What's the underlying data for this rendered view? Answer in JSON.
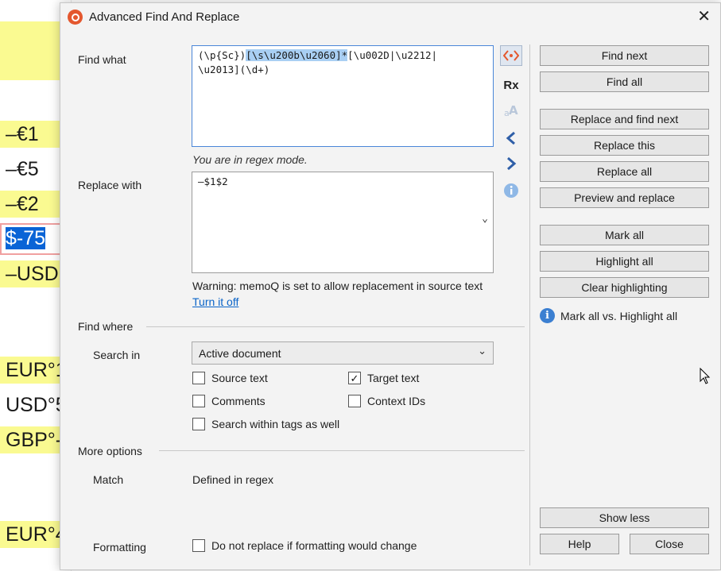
{
  "background_editor": {
    "cells": [
      {
        "text": "–€1",
        "yellow": true
      },
      {
        "text": "–€5",
        "yellow": false
      },
      {
        "text": "–€2",
        "yellow": true
      },
      {
        "text": "$-75",
        "yellow": false,
        "selected": true
      },
      {
        "text": "–USD",
        "yellow": true
      },
      {
        "text": "EUR°1",
        "yellow": true
      },
      {
        "text": "USD°5",
        "yellow": false
      },
      {
        "text": "GBP°-",
        "yellow": true
      },
      {
        "text": "EUR°4",
        "yellow": true
      }
    ]
  },
  "dialog": {
    "title": "Advanced Find And Replace",
    "close_glyph": "✕",
    "find_what": {
      "label": "Find what",
      "value_part1": "(\\p{Sc})",
      "value_highlight": "[\\s\\u200b\\u2060]*",
      "value_part2": "[\\u002D|\\u2212|",
      "value_line2": "\\u2013](\\d+)"
    },
    "regex_mode_note": "You are in regex mode.",
    "replace_with": {
      "label": "Replace with",
      "value": "–$1$2"
    },
    "warning": {
      "text": "Warning: memoQ is set to allow replacement in source text",
      "link": "Turn it off"
    },
    "find_where": {
      "heading": "Find where",
      "search_in_label": "Search in",
      "search_in_value": "Active document",
      "checkboxes": {
        "source_text": {
          "label": "Source text",
          "checked": false
        },
        "target_text": {
          "label": "Target text",
          "checked": true
        },
        "comments": {
          "label": "Comments",
          "checked": false
        },
        "context_ids": {
          "label": "Context IDs",
          "checked": false
        },
        "within_tags": {
          "label": "Search within tags as well",
          "checked": false
        }
      }
    },
    "more_options": {
      "heading": "More options",
      "match_label": "Match",
      "match_value": "Defined in regex",
      "formatting_label": "Formatting",
      "formatting_checkbox": {
        "label": "Do not replace if formatting would change",
        "checked": false
      }
    },
    "side_icons": [
      "regex-toggle-icon",
      "rx-icon",
      "font-case-icon",
      "previous-arrow-icon",
      "next-arrow-icon",
      "info-icon"
    ],
    "rx_label": "Rx",
    "buttons": {
      "find_next": "Find next",
      "find_all": "Find all",
      "replace_and_find_next": "Replace and find next",
      "replace_this": "Replace this",
      "replace_all": "Replace all",
      "preview_and_replace": "Preview and replace",
      "mark_all": "Mark all",
      "highlight_all": "Highlight all",
      "clear_highlighting": "Clear highlighting",
      "show_less": "Show less",
      "help": "Help",
      "close": "Close"
    },
    "info_link": "Mark all vs. Highlight all",
    "colors": {
      "accent": "#3b7fd1",
      "app_icon": "#e4572e",
      "highlight": "#a9cff3",
      "editor_yellow": "#fafa91"
    }
  }
}
